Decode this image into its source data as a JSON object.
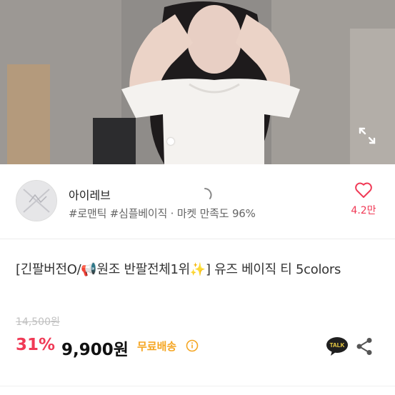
{
  "product_image": {
    "alt": "product photo",
    "indicator_icon": "carousel-dot-icon",
    "expand_icon": "fullscreen-expand-icon"
  },
  "shop": {
    "name": "아이레브",
    "tags": "#로맨틱 #심플베이직 · 마켓 만족도 96%",
    "avatar_icon": "shop-avatar-icon",
    "like_icon": "heart-outline-icon",
    "like_count": "4.2만",
    "loading_icon": "loading-spinner-icon"
  },
  "product": {
    "title": "[긴팔버전O/📢원조 반팔전체1위✨] 유즈 베이직 티 5colors",
    "original_price": "14,500원",
    "discount": "31%",
    "price": "9,900원",
    "shipping_badge": "무료배송",
    "info_icon": "info-circle-icon",
    "talk_icon": "kakaotalk-icon",
    "talk_label": "TALK",
    "share_icon": "share-icon"
  },
  "colors": {
    "accent_pink": "#f03a56",
    "shipping_orange": "#f5a623",
    "text_gray": "#666666"
  }
}
